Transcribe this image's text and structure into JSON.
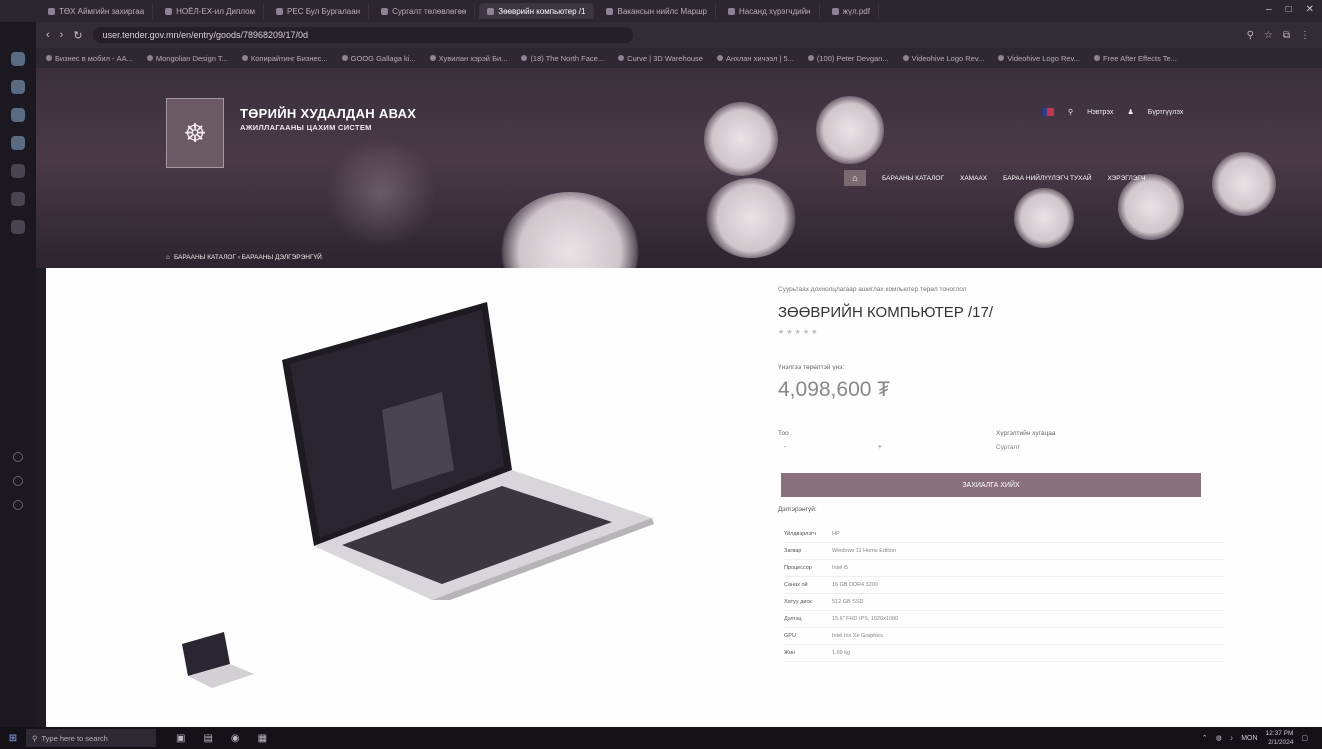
{
  "browser": {
    "tabs": [
      "ТӨХ Аймгийн захиргаа",
      "НОЁЛ-ЕХ-ил Диплом",
      "РЕС Бул Бургалаан",
      "Сургалт төлөвлөгөө",
      "Зөөврийн компьютер /1",
      "Вакансын нийлс Маршр",
      "Насанд хүрэгчдийн",
      "жүл.pdf"
    ],
    "active_tab_index": 4,
    "url": "user.tender.gov.mn/en/entry/goods/78968209/17/0d",
    "bookmarks": [
      "Бизнес в мобил - АА...",
      "Mongolian Design T...",
      "Копирайтинг Бизнеc...",
      "GOOG Gallagа ki...",
      "Хувилан хэрэй Би...",
      "(18) The North Face...",
      "Curve | 3D Warehouse",
      "Анхлан хичээл | 5...",
      "(100) Peter Devgan...",
      "Videohive Logo Rev...",
      "Videohive Logo Rev...",
      "Free After Effects Te..."
    ]
  },
  "site": {
    "title_line1": "ТӨРИЙН ХУДАЛДАН АВАХ",
    "title_line2": "АЖИЛЛАГААНЫ ЦАХИМ СИСТЕМ",
    "util_links": [
      "Нэвтрэх",
      "Бүртгүүлэх"
    ],
    "nav": [
      "БАРААНЫ КАТАЛОГ",
      "ХАМААХ",
      "БАРАА НИЙЛҮҮЛЭГЧ ТУХАЙ",
      "ХЭРЭГЛЭГЧ"
    ],
    "breadcrumb": "БАРААНЫ КАТАЛОГ › БАРААНЫ ДЭЛГЭРЭНГҮЙ"
  },
  "product": {
    "category": "Суурьтаах дохиолцлагаар ашиглах компьютер төрөл тоноглол",
    "title": "ЗӨӨВРИЙН КОМПЬЮТЕР /17/",
    "stars": "★★★★★",
    "price_label": "Үнэлгээ төрөлтэй үнэ:",
    "price": "4,098,600 ₮",
    "qty_label": "Тоо",
    "qty_minus": "-",
    "qty_plus": "+",
    "delivery_label": "Хүргэлтийн хугацаа",
    "delivery_value": "Сургалт",
    "order_button": "ЗАХИАЛГА ХИЙХ",
    "desc_label": "Дэлгэрэнгүй:",
    "specs": [
      {
        "k": "Үйлдвэрлэгч",
        "v": "HP"
      },
      {
        "k": "Загвар",
        "v": "Windows 11 Home Edition"
      },
      {
        "k": "Процессор",
        "v": "Intel i5"
      },
      {
        "k": "Санах ой",
        "v": "16 GB DDR4 3200"
      },
      {
        "k": "Хатуу диск",
        "v": "512 GB SSD"
      },
      {
        "k": "Дэлгэц",
        "v": "15.6\" FHD IPS, 1920x1080"
      },
      {
        "k": "GPU",
        "v": "Intel Iris Xe Graphics"
      },
      {
        "k": "Жин",
        "v": "1.69 kg"
      }
    ]
  },
  "taskbar": {
    "search_placeholder": "Type here to search",
    "lang": "MON",
    "time": "12:37 PM",
    "date": "2/1/2024"
  }
}
